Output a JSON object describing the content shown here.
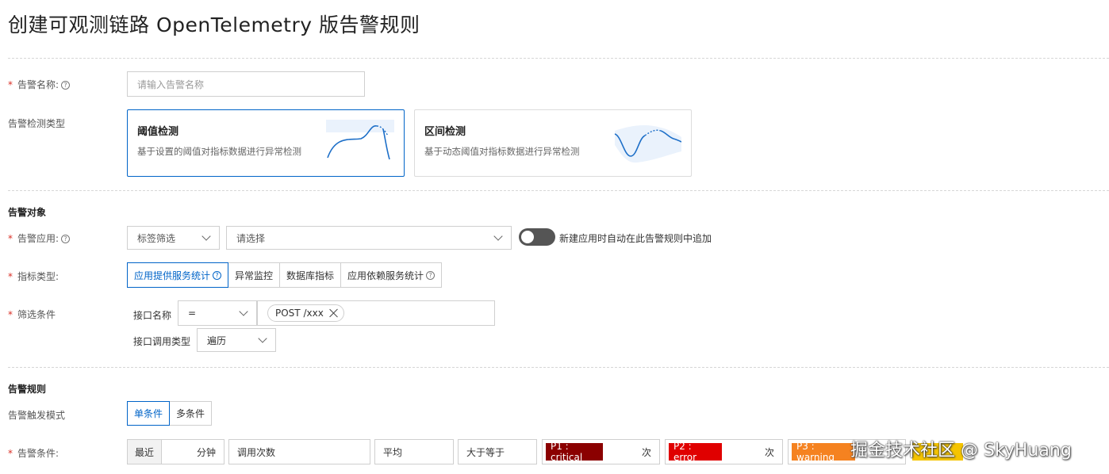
{
  "page": {
    "title": "创建可观测链路 OpenTelemetry 版告警规则"
  },
  "colors": {
    "accent": "#0064c8",
    "required": "#d93026",
    "p1": "#8b0000",
    "p2": "#e00000",
    "p3": "#f58220",
    "p4": "#f5c400"
  },
  "form": {
    "required_mark": "*",
    "help_glyph": "?",
    "alert_name": {
      "label": "告警名称:",
      "placeholder": "请输入告警名称"
    },
    "detect_type": {
      "label": "告警检测类型",
      "options": [
        {
          "title": "阈值检测",
          "desc": "基于设置的阈值对指标数据进行异常检测",
          "selected": true,
          "icon": "threshold-chart-icon"
        },
        {
          "title": "区间检测",
          "desc": "基于动态阈值对指标数据进行异常检测",
          "selected": false,
          "icon": "interval-chart-icon"
        }
      ]
    }
  },
  "target": {
    "section_title": "告警对象",
    "app": {
      "label": "告警应用:",
      "filter_select": "标签筛选",
      "app_select_placeholder": "请选择",
      "toggle_label": "新建应用时自动在此告警规则中追加",
      "toggle_on": false
    },
    "metric_type": {
      "label": "指标类型:",
      "options": [
        "应用提供服务统计",
        "异常监控",
        "数据库指标",
        "应用依赖服务统计"
      ],
      "selected_index": 0
    },
    "filter": {
      "label": "筛选条件",
      "rows": [
        {
          "name": "接口名称",
          "operator": "=",
          "tags": [
            "POST /xxx"
          ]
        },
        {
          "name": "接口调用类型",
          "value": "遍历"
        }
      ]
    }
  },
  "rules": {
    "section_title": "告警规则",
    "trigger_mode": {
      "label": "告警触发模式",
      "options": [
        "单条件",
        "多条件"
      ],
      "selected_index": 0
    },
    "condition": {
      "label": "告警条件:",
      "recent_prefix": "最近",
      "minutes_suffix": "分钟",
      "metric": "调用次数",
      "aggregation": "平均",
      "comparator": "大于等于",
      "count_unit": "次",
      "levels": [
        "P1 : critical",
        "P2 : error",
        "P3 : warning"
      ]
    }
  },
  "watermark": "掘金技术社区 @ SkyHuang"
}
